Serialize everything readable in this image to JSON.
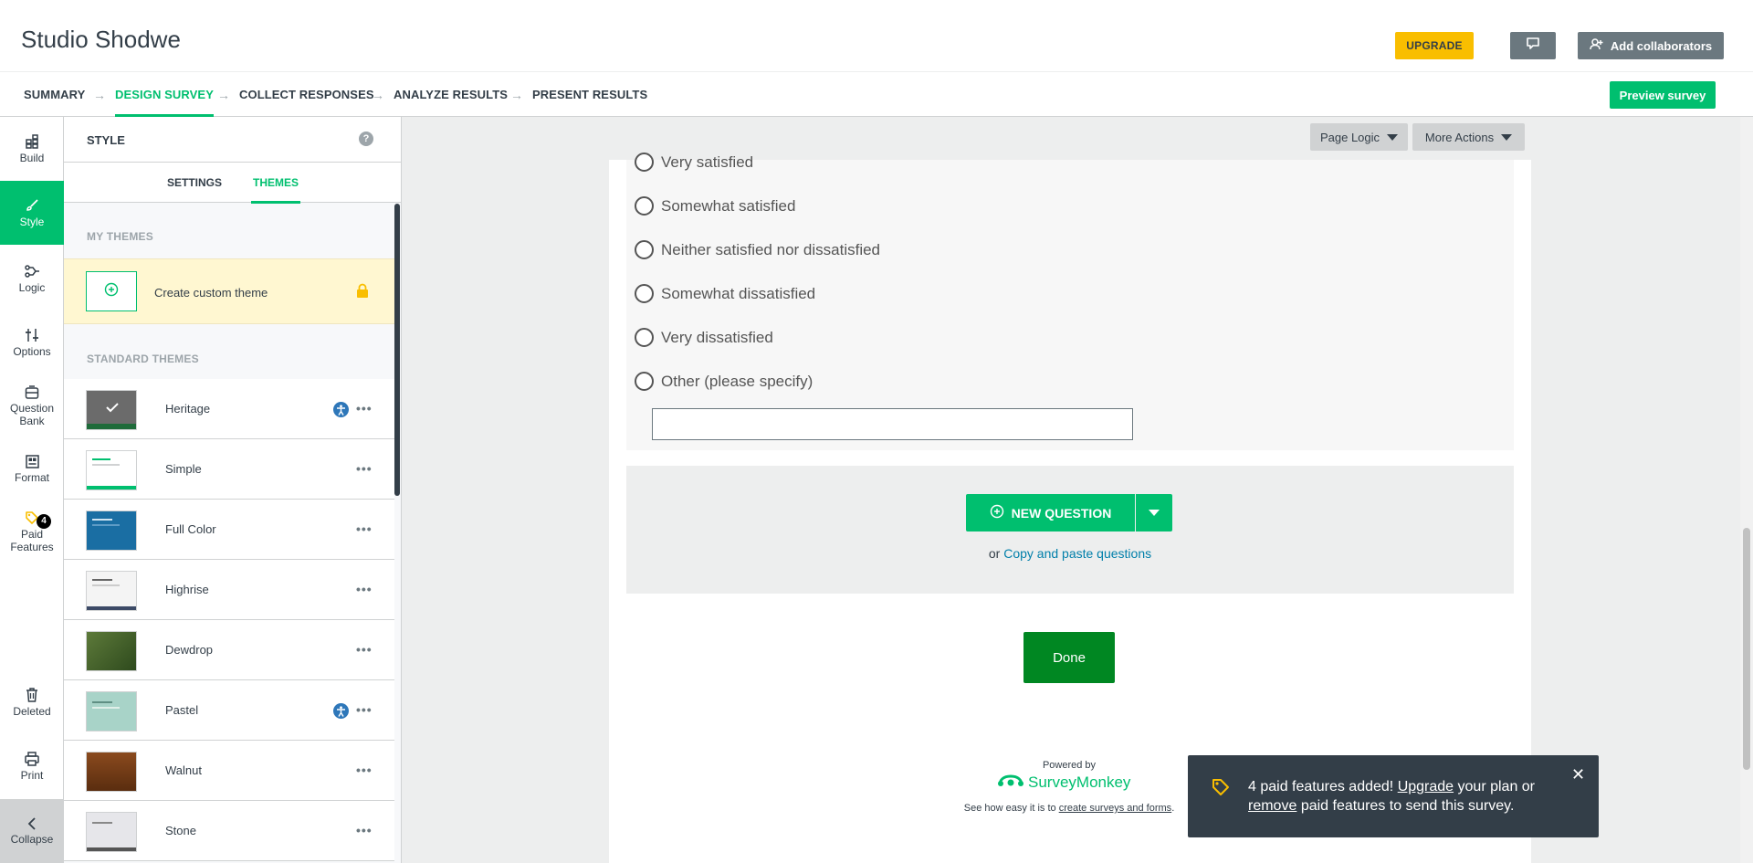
{
  "header": {
    "title": "Studio Shodwe",
    "upgrade_label": "UPGRADE",
    "collab_label": "Add collaborators",
    "preview_label": "Preview survey"
  },
  "nav": {
    "items": [
      "SUMMARY",
      "DESIGN SURVEY",
      "COLLECT RESPONSES",
      "ANALYZE RESULTS",
      "PRESENT RESULTS"
    ],
    "active": "DESIGN SURVEY"
  },
  "rail": {
    "items": [
      {
        "label": "Build",
        "icon": "build-icon"
      },
      {
        "label": "Style",
        "icon": "brush-icon"
      },
      {
        "label": "Logic",
        "icon": "logic-icon"
      },
      {
        "label": "Options",
        "icon": "sliders-icon"
      },
      {
        "label": "Question Bank",
        "icon": "bank-icon"
      },
      {
        "label": "Format",
        "icon": "format-icon"
      },
      {
        "label": "Paid Features",
        "icon": "tag-icon",
        "badge": "4"
      },
      {
        "label": "Deleted",
        "icon": "trash-icon"
      },
      {
        "label": "Print",
        "icon": "print-icon"
      }
    ],
    "collapse_label": "Collapse"
  },
  "panel": {
    "title": "STYLE",
    "help": "?",
    "tabs": [
      "SETTINGS",
      "THEMES"
    ],
    "active_tab": "THEMES",
    "my_themes_label": "MY THEMES",
    "custom_theme_label": "Create custom theme",
    "standard_themes_label": "STANDARD THEMES",
    "themes": [
      {
        "name": "Heritage",
        "accessible": true,
        "selected": true
      },
      {
        "name": "Simple",
        "accessible": false
      },
      {
        "name": "Full Color",
        "accessible": false
      },
      {
        "name": "Highrise",
        "accessible": false
      },
      {
        "name": "Dewdrop",
        "accessible": false
      },
      {
        "name": "Pastel",
        "accessible": true
      },
      {
        "name": "Walnut",
        "accessible": false
      },
      {
        "name": "Stone",
        "accessible": false
      }
    ],
    "more_glyph": "•••"
  },
  "canvas": {
    "page_logic_label": "Page Logic",
    "more_actions_label": "More Actions",
    "choices": [
      "Very satisfied",
      "Somewhat satisfied",
      "Neither satisfied nor dissatisfied",
      "Somewhat dissatisfied",
      "Very dissatisfied",
      "Other (please specify)"
    ],
    "new_question_label": "NEW QUESTION",
    "copy_prefix": "or",
    "copy_link": "Copy and paste questions",
    "done_label": "Done",
    "powered_by": "Powered by",
    "brand": "SurveyMonkey",
    "see_how_prefix": "See how easy it is to",
    "see_how_link": "create surveys and forms",
    "see_how_suffix": "."
  },
  "toast": {
    "part1": "4 paid features added!",
    "upgrade_link": "Upgrade",
    "part2": "your plan or",
    "remove_link": "remove",
    "part3": "paid features to send this survey.",
    "close": "✕"
  },
  "colors": {
    "brand_green": "#00bf6f",
    "done_green": "#008722",
    "upgrade_yellow": "#f9be00",
    "dark": "#333e48",
    "link_blue": "#007faa"
  }
}
